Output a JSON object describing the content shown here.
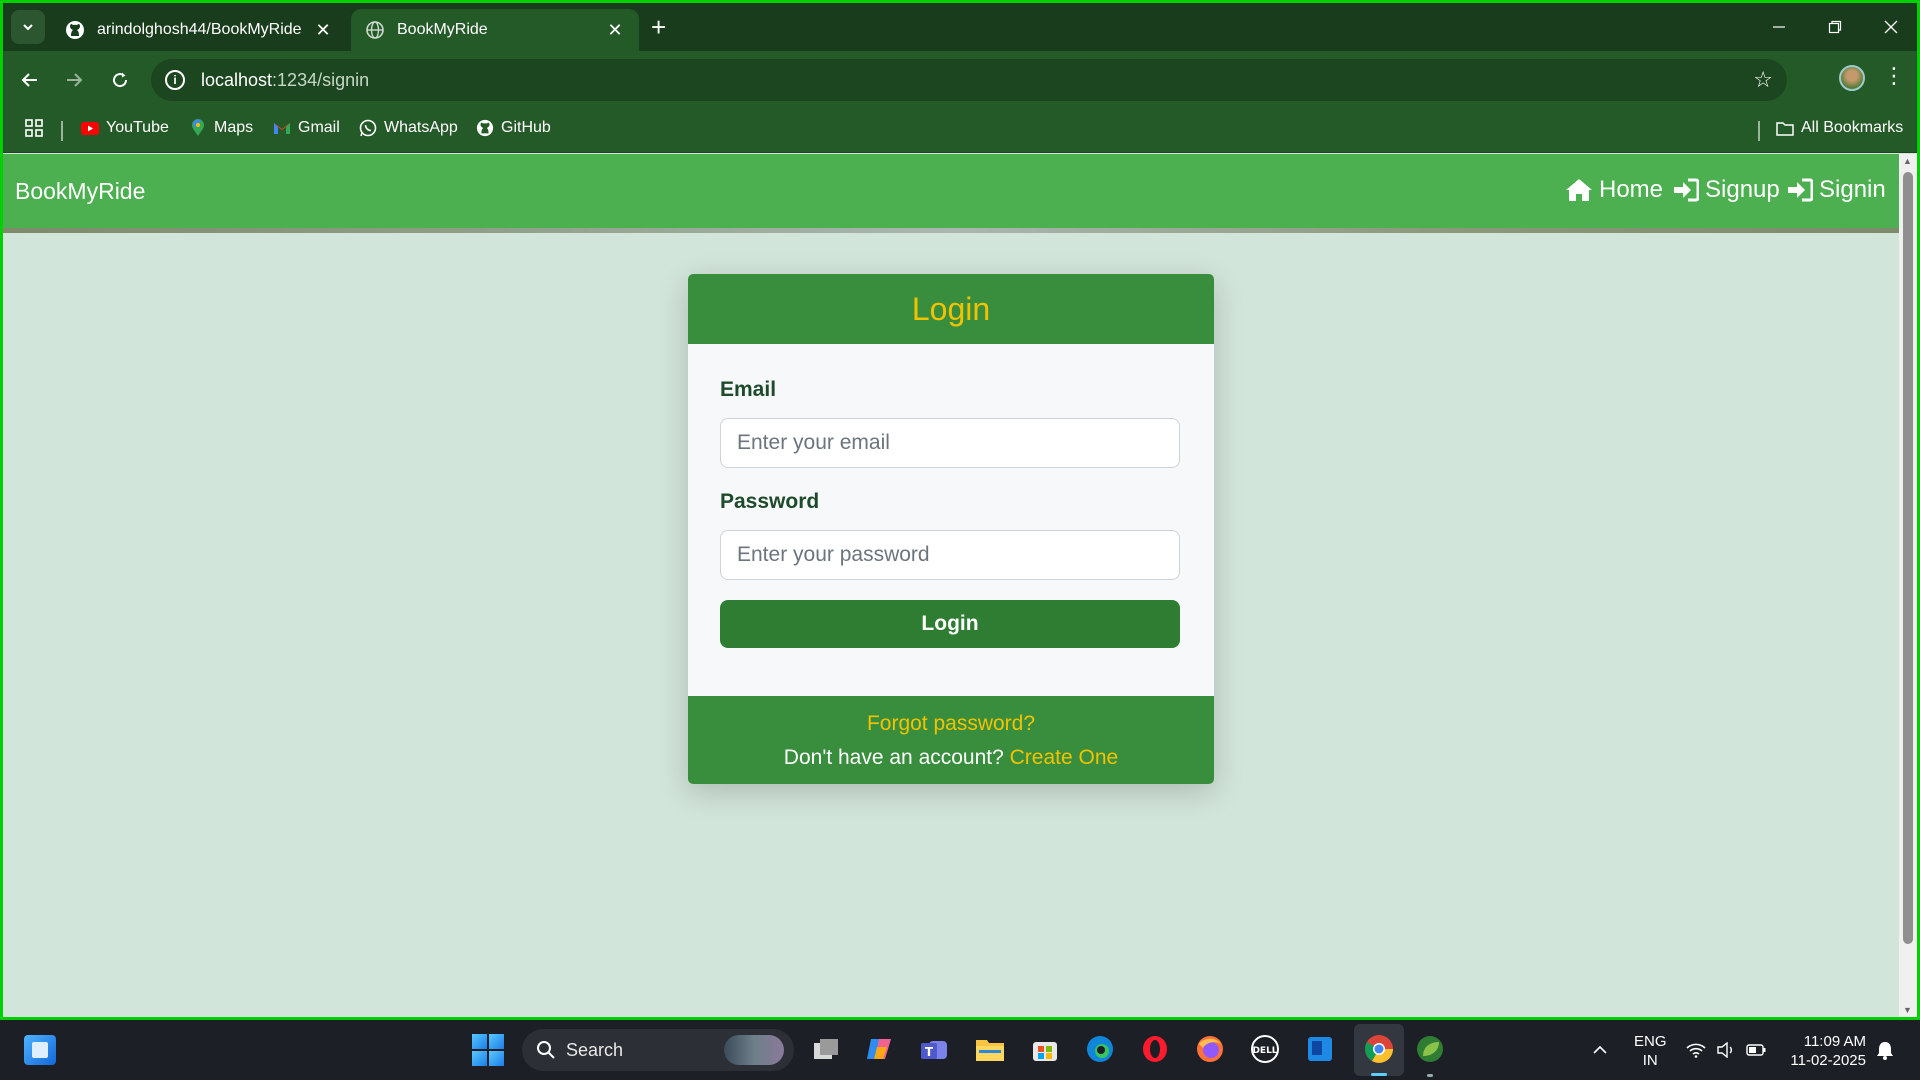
{
  "browser": {
    "tabs": [
      {
        "title": "arindolghosh44/BookMyRide",
        "close": "✕"
      },
      {
        "title": "BookMyRide",
        "close": "✕"
      }
    ],
    "new_tab": "+",
    "url_host": "localhost",
    "url_path": ":1234/signin",
    "bookmarks": [
      {
        "label": "YouTube",
        "icon": "youtube-icon"
      },
      {
        "label": "Maps",
        "icon": "maps-icon"
      },
      {
        "label": "Gmail",
        "icon": "gmail-icon"
      },
      {
        "label": "WhatsApp",
        "icon": "whatsapp-icon"
      },
      {
        "label": "GitHub",
        "icon": "github-icon"
      }
    ],
    "all_bookmarks": "All Bookmarks"
  },
  "page": {
    "brand": "BookMyRide",
    "nav": [
      {
        "label": "Home",
        "icon": "home-icon"
      },
      {
        "label": "Signup",
        "icon": "sign-in-icon"
      },
      {
        "label": "Signin",
        "icon": "sign-in-icon"
      }
    ],
    "login": {
      "title": "Login",
      "email_label": "Email",
      "email_placeholder": "Enter your email",
      "password_label": "Password",
      "password_placeholder": "Enter your password",
      "button": "Login",
      "forgot": "Forgot password?",
      "no_account": "Don't have an account?",
      "create": "Create One"
    }
  },
  "taskbar": {
    "search_label": "Search",
    "lang_line1": "ENG",
    "lang_line2": "IN",
    "time": "11:09 AM",
    "date": "11-02-2025"
  },
  "colors": {
    "navbar": "#4caf50",
    "card_header": "#388e3c",
    "accent_text": "#f2c200",
    "button": "#2e7d32",
    "page_bg": "#d2e5da"
  }
}
